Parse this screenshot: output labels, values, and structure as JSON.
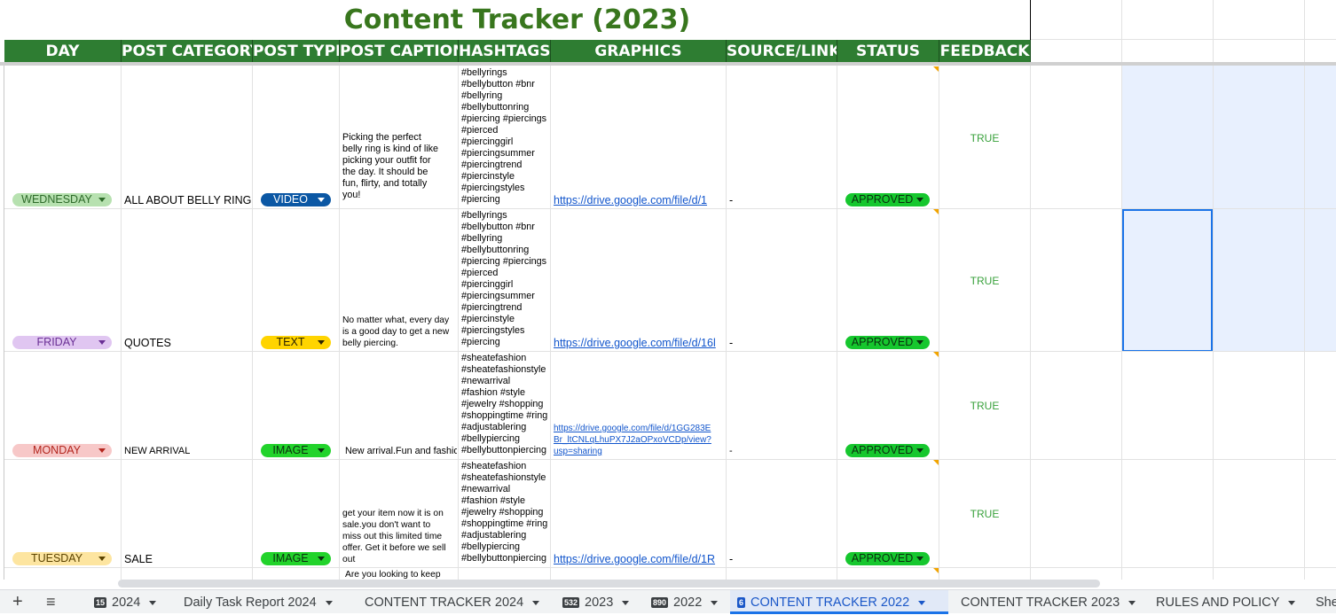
{
  "title": "Content Tracker (2023)",
  "headers": [
    "DAY",
    "POST CATEGORY",
    "POST TYPE",
    "POST CAPTION",
    "HASHTAGS",
    "GRAPHICS",
    "SOURCE/LINK",
    "STATUS",
    "FEEDBACK"
  ],
  "rows": [
    {
      "day": "WEDNESDAY",
      "category": "ALL ABOUT BELLY RINGS",
      "type": "VIDEO",
      "caption": "Picking the perfect\nbelly ring is kind of like\npicking your outfit for\nthe day. It should be\nfun, flirty, and totally\nyou!",
      "hashtags": "#bellyrings\n#bellybutton #bnr\n#bellyring\n#bellybuttonring\n#piercing #piercings\n#pierced\n#piercinggirl\n#piercingsummer\n#piercingtrend\n#piercinstyle\n#piercingstyles\n#piercing",
      "graphics": "https://drive.google.com/file/d/1",
      "source": "-",
      "status": "APPROVED",
      "feedback": "TRUE"
    },
    {
      "day": "FRIDAY",
      "category": "QUOTES",
      "type": "TEXT",
      "caption": "No matter what, every day\nis a good day to get a new\nbelly piercing.",
      "hashtags": "#bellyrings\n#bellybutton #bnr\n#bellyring\n#bellybuttonring\n#piercing #piercings\n#pierced\n#piercinggirl\n#piercingsummer\n#piercingtrend\n#piercinstyle\n#piercingstyles\n#piercing",
      "graphics": "https://drive.google.com/file/d/16l",
      "source": "-",
      "status": "APPROVED",
      "feedback": "TRUE"
    },
    {
      "day": "MONDAY",
      "category": "NEW ARRIVAL",
      "type": "IMAGE",
      "caption": "New arrival.Fun and fashion",
      "hashtags": "#sheatefashion\n#sheatefashionstyle\n#newarrival\n#fashion #style\n#jewelry #shopping\n#shoppingtime #ring\n#adjustablering\n#bellypiercing\n#bellybuttonpiercing",
      "graphics": "https://drive.google.com/file/d/1GG283E\nBr_ltCNLqLhuPX7J2aOPxoVCDp/view?\nusp=sharing",
      "source": "-",
      "status": "APPROVED",
      "feedback": "TRUE"
    },
    {
      "day": "TUESDAY",
      "category": "SALE",
      "type": "IMAGE",
      "caption": "get your item now it is on\nsale.you don't want to\nmiss out this limited time\noffer. Get it before we sell\nout",
      "hashtags": "#sheatefashion\n#sheatefashionstyle\n#newarrival\n#fashion #style\n#jewelry #shopping\n#shoppingtime #ring\n#adjustablering\n#bellypiercing\n#bellybuttonpiercing",
      "graphics": "https://drive.google.com/file/d/1R",
      "source": "-",
      "status": "APPROVED",
      "feedback": "TRUE"
    }
  ],
  "partial_caption": "Are you looking to keep",
  "colors": {
    "header_green": "#2e7d32",
    "title_green": "#38761d",
    "approved": "#16c72e",
    "video": "#0b57a4",
    "text": "#ffd400",
    "image": "#22d32b"
  },
  "tabs": [
    {
      "badge": "15",
      "label": "2024"
    },
    {
      "badge": "",
      "label": "Daily Task Report 2024"
    },
    {
      "badge": "",
      "label": "CONTENT TRACKER 2024"
    },
    {
      "badge": "532",
      "label": "2023"
    },
    {
      "badge": "890",
      "label": "2022"
    },
    {
      "badge": "6",
      "label": "CONTENT TRACKER 2022"
    },
    {
      "badge": "",
      "label": "CONTENT TRACKER 2023"
    },
    {
      "badge": "",
      "label": "RULES AND POLICY"
    },
    {
      "badge": "",
      "label": "She"
    }
  ],
  "add_sheet_label": "+",
  "all_sheets_label": "≡"
}
